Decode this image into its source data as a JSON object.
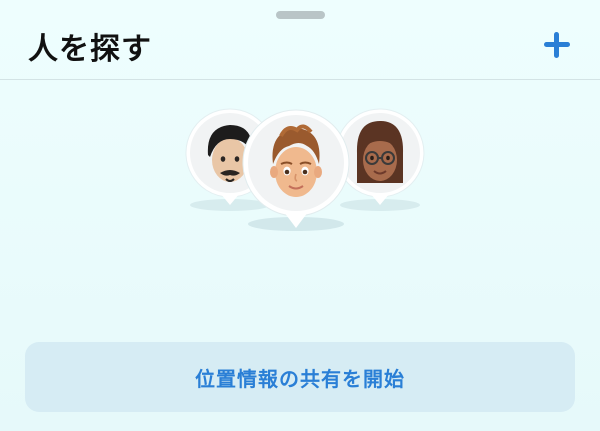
{
  "header": {
    "title": "人を探す",
    "add_icon": "plus-icon"
  },
  "avatars": [
    {
      "name": "memoji-avatar-dark-hair"
    },
    {
      "name": "memoji-avatar-curly-hair"
    },
    {
      "name": "memoji-avatar-glasses"
    }
  ],
  "cta": {
    "label": "位置情報の共有を開始"
  },
  "colors": {
    "accent": "#2a7fd6",
    "background": "#e9fbfb",
    "cta_background": "#d6ecf4"
  }
}
